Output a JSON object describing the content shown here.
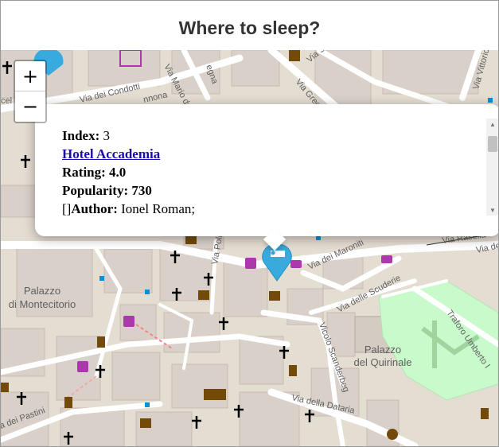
{
  "header": {
    "title": "Where to sleep?"
  },
  "zoom": {
    "in_label": "+",
    "out_label": "−"
  },
  "popup": {
    "index_label": "Index:",
    "index_value": "3",
    "hotel_name": "Hotel Accademia",
    "rating_label": "Rating:",
    "rating_value": "4.0",
    "popularity_label": "Popularity:",
    "popularity_value": "730",
    "author_prefix": "[]",
    "author_label": "Author:",
    "author_value": "Ionel Roman;"
  },
  "map": {
    "streets": {
      "via_dei_condotti": "Via dei Condotti",
      "via_mario_de": "Via Mario de",
      "via_sistina": "Via Sistina",
      "via_gregor": "Via Gregor",
      "via_vittorio_ve": "Via Vittorio Ve",
      "via_rasella": "Via Rasella",
      "via_de": "Via de",
      "via_dei_maroniti": "Via dei Maroniti",
      "via_delle_scuderie": "Via delle Scuderie",
      "vicolo_scanderbeg": "Vicolo Scanderbeg",
      "traforo_umberto": "Traforo Umberto I",
      "via_della_dataria": "Via della Dataria",
      "via_dei_pastini": "a dei Pastini",
      "via_poli": "Via Poli",
      "frag_nnona": "nnona",
      "frag_cel": "cel",
      "frag_egna": "egna"
    },
    "places": {
      "palazzo_montecitorio_l1": "Palazzo",
      "palazzo_montecitorio_l2": "di Montecitorio",
      "palazzo_quirinale_l1": "Palazzo",
      "palazzo_quirinale_l2": "del Quirinale"
    },
    "colors": {
      "land": "#e4ddd2",
      "street": "#ffffff",
      "building": "#d9d0c9",
      "park": "#c8facc",
      "marker": "#38aadd",
      "church": "#000000",
      "shop": "#ac39ac",
      "tourism": "#734a08"
    }
  }
}
